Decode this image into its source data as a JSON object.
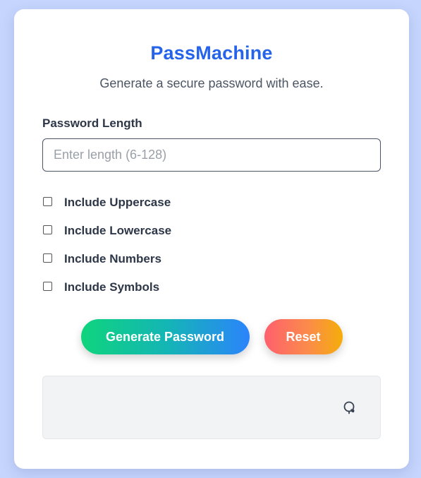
{
  "app": {
    "title": "PassMachine",
    "subtitle": "Generate a secure password with ease."
  },
  "length_field": {
    "label": "Password Length",
    "value": "",
    "placeholder": "Enter length (6-128)"
  },
  "options": [
    {
      "label": "Include Uppercase",
      "checked": false
    },
    {
      "label": "Include Lowercase",
      "checked": false
    },
    {
      "label": "Include Numbers",
      "checked": false
    },
    {
      "label": "Include Symbols",
      "checked": false
    }
  ],
  "buttons": {
    "generate_label": "Generate Password",
    "reset_label": "Reset"
  },
  "output": {
    "password": "",
    "copy_icon": "copy-icon"
  },
  "colors": {
    "background": "#c5d5fd",
    "title": "#2563eb",
    "generate_gradient": [
      "#0fd47d",
      "#2b84fb"
    ],
    "reset_gradient": [
      "#ff5f6d",
      "#f5ad0a"
    ]
  }
}
